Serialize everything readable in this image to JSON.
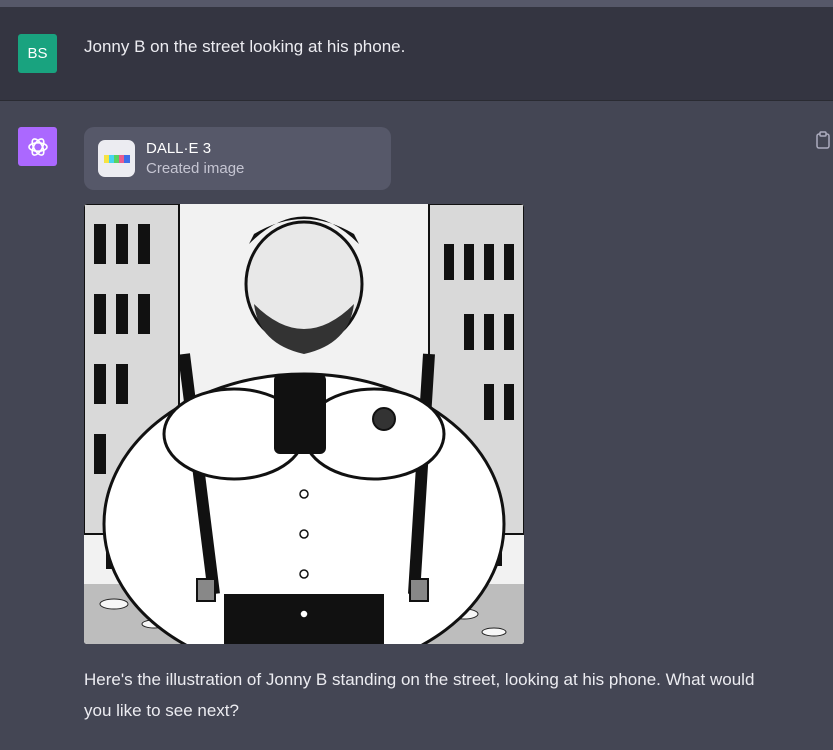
{
  "user": {
    "avatar_initials": "BS",
    "message": "Jonny B on the street looking at his phone."
  },
  "assistant": {
    "tool": {
      "title": "DALL·E 3",
      "subtitle": "Created image"
    },
    "reply": "Here's the illustration of Jonny B standing on the street, looking at his phone. What would you like to see next?"
  },
  "colors": {
    "user_row_bg": "#343541",
    "assistant_row_bg": "#444654",
    "user_avatar": "#19a37f",
    "assistant_avatar": "#ab68ff"
  },
  "icons": [
    "openai-logo-icon",
    "dalle-palette-icon",
    "clipboard-icon"
  ]
}
